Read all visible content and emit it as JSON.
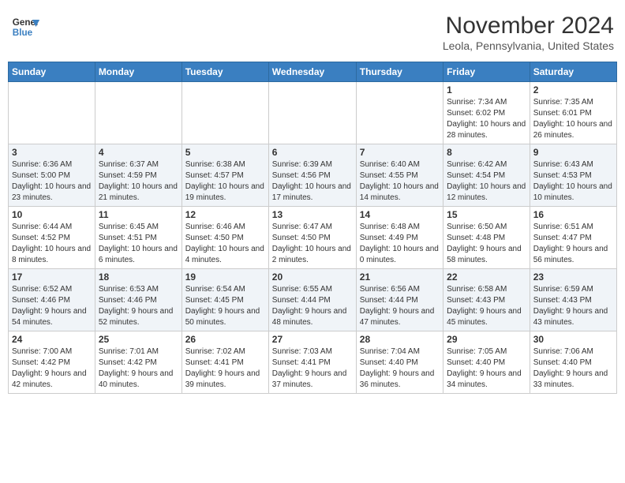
{
  "header": {
    "logo_line1": "General",
    "logo_line2": "Blue",
    "month": "November 2024",
    "location": "Leola, Pennsylvania, United States"
  },
  "days_of_week": [
    "Sunday",
    "Monday",
    "Tuesday",
    "Wednesday",
    "Thursday",
    "Friday",
    "Saturday"
  ],
  "weeks": [
    [
      {
        "day": "",
        "info": ""
      },
      {
        "day": "",
        "info": ""
      },
      {
        "day": "",
        "info": ""
      },
      {
        "day": "",
        "info": ""
      },
      {
        "day": "",
        "info": ""
      },
      {
        "day": "1",
        "info": "Sunrise: 7:34 AM\nSunset: 6:02 PM\nDaylight: 10 hours and 28 minutes."
      },
      {
        "day": "2",
        "info": "Sunrise: 7:35 AM\nSunset: 6:01 PM\nDaylight: 10 hours and 26 minutes."
      }
    ],
    [
      {
        "day": "3",
        "info": "Sunrise: 6:36 AM\nSunset: 5:00 PM\nDaylight: 10 hours and 23 minutes."
      },
      {
        "day": "4",
        "info": "Sunrise: 6:37 AM\nSunset: 4:59 PM\nDaylight: 10 hours and 21 minutes."
      },
      {
        "day": "5",
        "info": "Sunrise: 6:38 AM\nSunset: 4:57 PM\nDaylight: 10 hours and 19 minutes."
      },
      {
        "day": "6",
        "info": "Sunrise: 6:39 AM\nSunset: 4:56 PM\nDaylight: 10 hours and 17 minutes."
      },
      {
        "day": "7",
        "info": "Sunrise: 6:40 AM\nSunset: 4:55 PM\nDaylight: 10 hours and 14 minutes."
      },
      {
        "day": "8",
        "info": "Sunrise: 6:42 AM\nSunset: 4:54 PM\nDaylight: 10 hours and 12 minutes."
      },
      {
        "day": "9",
        "info": "Sunrise: 6:43 AM\nSunset: 4:53 PM\nDaylight: 10 hours and 10 minutes."
      }
    ],
    [
      {
        "day": "10",
        "info": "Sunrise: 6:44 AM\nSunset: 4:52 PM\nDaylight: 10 hours and 8 minutes."
      },
      {
        "day": "11",
        "info": "Sunrise: 6:45 AM\nSunset: 4:51 PM\nDaylight: 10 hours and 6 minutes."
      },
      {
        "day": "12",
        "info": "Sunrise: 6:46 AM\nSunset: 4:50 PM\nDaylight: 10 hours and 4 minutes."
      },
      {
        "day": "13",
        "info": "Sunrise: 6:47 AM\nSunset: 4:50 PM\nDaylight: 10 hours and 2 minutes."
      },
      {
        "day": "14",
        "info": "Sunrise: 6:48 AM\nSunset: 4:49 PM\nDaylight: 10 hours and 0 minutes."
      },
      {
        "day": "15",
        "info": "Sunrise: 6:50 AM\nSunset: 4:48 PM\nDaylight: 9 hours and 58 minutes."
      },
      {
        "day": "16",
        "info": "Sunrise: 6:51 AM\nSunset: 4:47 PM\nDaylight: 9 hours and 56 minutes."
      }
    ],
    [
      {
        "day": "17",
        "info": "Sunrise: 6:52 AM\nSunset: 4:46 PM\nDaylight: 9 hours and 54 minutes."
      },
      {
        "day": "18",
        "info": "Sunrise: 6:53 AM\nSunset: 4:46 PM\nDaylight: 9 hours and 52 minutes."
      },
      {
        "day": "19",
        "info": "Sunrise: 6:54 AM\nSunset: 4:45 PM\nDaylight: 9 hours and 50 minutes."
      },
      {
        "day": "20",
        "info": "Sunrise: 6:55 AM\nSunset: 4:44 PM\nDaylight: 9 hours and 48 minutes."
      },
      {
        "day": "21",
        "info": "Sunrise: 6:56 AM\nSunset: 4:44 PM\nDaylight: 9 hours and 47 minutes."
      },
      {
        "day": "22",
        "info": "Sunrise: 6:58 AM\nSunset: 4:43 PM\nDaylight: 9 hours and 45 minutes."
      },
      {
        "day": "23",
        "info": "Sunrise: 6:59 AM\nSunset: 4:43 PM\nDaylight: 9 hours and 43 minutes."
      }
    ],
    [
      {
        "day": "24",
        "info": "Sunrise: 7:00 AM\nSunset: 4:42 PM\nDaylight: 9 hours and 42 minutes."
      },
      {
        "day": "25",
        "info": "Sunrise: 7:01 AM\nSunset: 4:42 PM\nDaylight: 9 hours and 40 minutes."
      },
      {
        "day": "26",
        "info": "Sunrise: 7:02 AM\nSunset: 4:41 PM\nDaylight: 9 hours and 39 minutes."
      },
      {
        "day": "27",
        "info": "Sunrise: 7:03 AM\nSunset: 4:41 PM\nDaylight: 9 hours and 37 minutes."
      },
      {
        "day": "28",
        "info": "Sunrise: 7:04 AM\nSunset: 4:40 PM\nDaylight: 9 hours and 36 minutes."
      },
      {
        "day": "29",
        "info": "Sunrise: 7:05 AM\nSunset: 4:40 PM\nDaylight: 9 hours and 34 minutes."
      },
      {
        "day": "30",
        "info": "Sunrise: 7:06 AM\nSunset: 4:40 PM\nDaylight: 9 hours and 33 minutes."
      }
    ]
  ]
}
